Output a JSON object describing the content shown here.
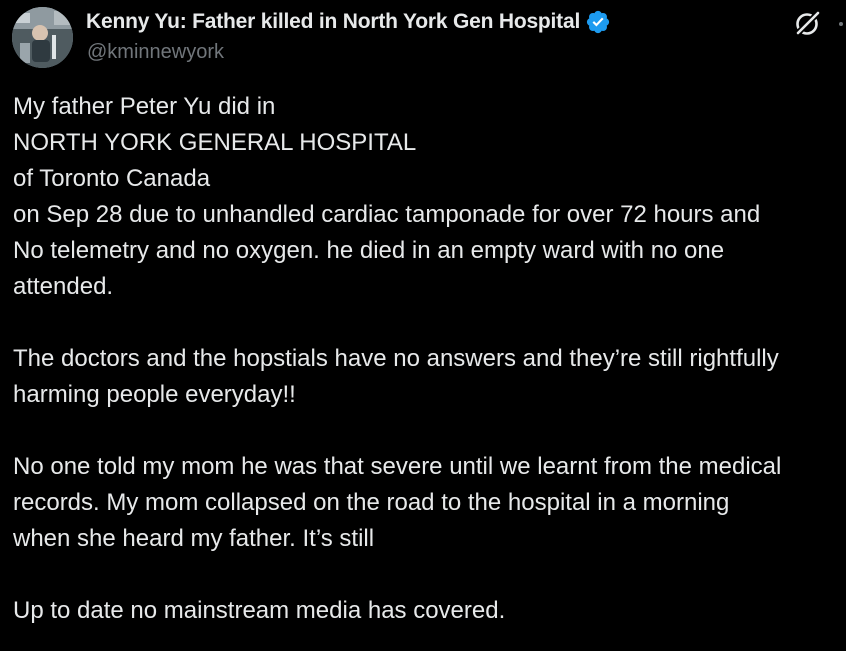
{
  "author": {
    "display_name": "Kenny Yu: Father killed in North York Gen Hospital",
    "handle": "@kminnewyork",
    "verified": true,
    "verified_color": "#1d9bf0",
    "avatar_icon": "profile-photo"
  },
  "actions": {
    "grok_icon": "grok-icon",
    "more_icon": "more-dots-icon"
  },
  "tweet": {
    "lines": [
      "My father Peter Yu did in",
      "NORTH YORK GENERAL HOSPITAL",
      "of Toronto Canada",
      "on Sep 28 due to unhandled cardiac tamponade for over 72 hours and",
      "No telemetry and no oxygen. he died in an empty ward with no one",
      "attended.",
      "",
      "The doctors and the hopstials have no answers and they’re still rightfully",
      "harming people everyday!!",
      "",
      "No one told my mom he was that severe until we learnt from the medical",
      "records. My mom collapsed on the road to the hospital in a morning",
      "when she heard my father. It’s still",
      "",
      "Up to date no mainstream media has covered."
    ]
  }
}
